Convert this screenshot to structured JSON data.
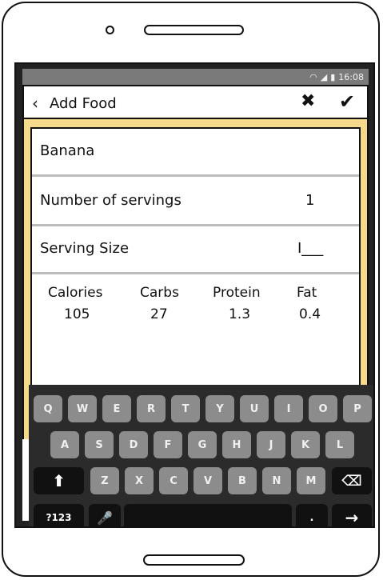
{
  "status_bar": {
    "time": "16:08",
    "wifi_icon": "wifi-icon",
    "signal_icon": "signal-icon",
    "battery_icon": "battery-icon"
  },
  "app_bar": {
    "back_icon": "‹",
    "title": "Add Food",
    "cancel_icon": "✖",
    "confirm_icon": "✔"
  },
  "food": {
    "name": "Banana"
  },
  "servings": {
    "label": "Number of servings",
    "value": "1"
  },
  "serving_size": {
    "label": "Serving Size",
    "value": "I___"
  },
  "nutrition": {
    "headers": [
      "Calories",
      "Carbs",
      "Protein",
      "Fat"
    ],
    "values": [
      "105",
      "27",
      "1.3",
      "0.4"
    ]
  },
  "keyboard": {
    "row1": [
      "Q",
      "W",
      "E",
      "R",
      "T",
      "Y",
      "U",
      "I",
      "O",
      "P"
    ],
    "row2": [
      "A",
      "S",
      "D",
      "F",
      "G",
      "H",
      "J",
      "K",
      "L"
    ],
    "row3": [
      "Z",
      "X",
      "C",
      "V",
      "B",
      "N",
      "M"
    ],
    "shift": "⬆",
    "backspace": "⌫",
    "symbols": "?123",
    "mic": "🎤",
    "period": ".",
    "enter": "→"
  },
  "colors": {
    "accent": "#f7d98c",
    "key": "#8c8c8c",
    "key_dark": "#111111"
  }
}
